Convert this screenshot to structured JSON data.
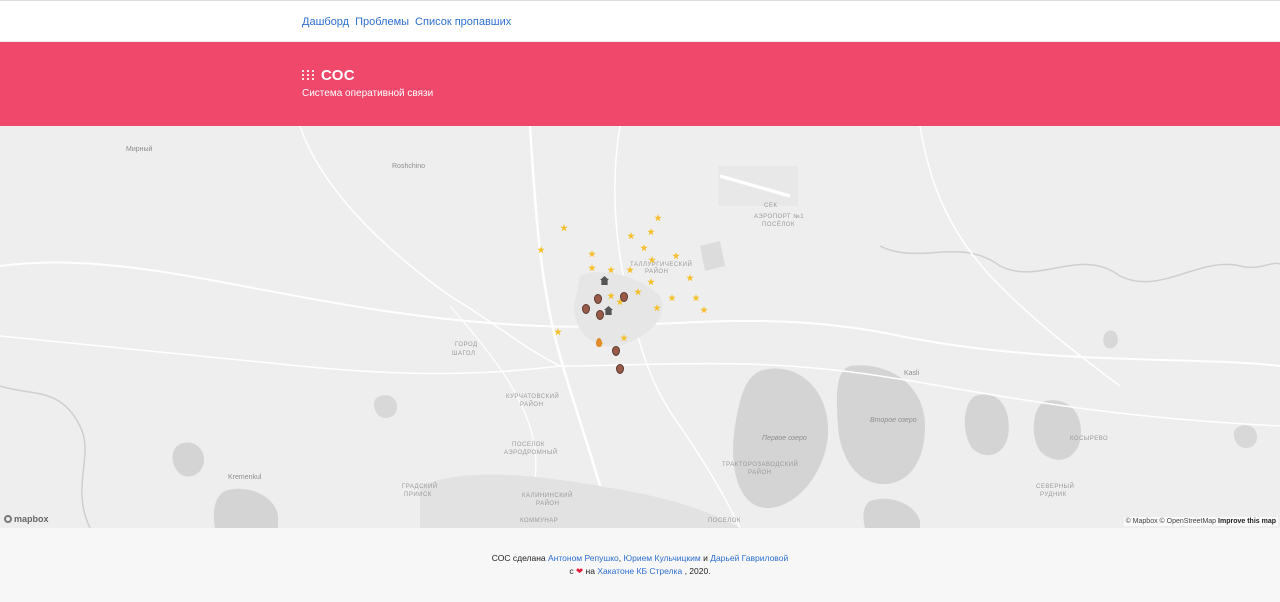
{
  "nav": {
    "dashboard": "Дашборд",
    "problems": "Проблемы",
    "missing_list": "Список пропавших"
  },
  "hero": {
    "title": "СОС",
    "subtitle": "Система оперативной связи"
  },
  "map": {
    "labels": {
      "mirny": "Мирный",
      "roshchino": "Roshchino",
      "airport": "АЭРОПОРТ №1",
      "airport2": "ПОСЁЛОК",
      "sek": "СЕК",
      "district_top": "ТАЛЛУРГИЧЕСКИЙ",
      "district_top2": "РАЙОН",
      "gorod": "ГОРОД",
      "shagol": "ШАГОЛ",
      "kurchatov": "КУРЧАТОВСКИЙ",
      "kurchatov2": "РАЙОН",
      "aerodromny": "ПОСЕЛОК",
      "aerodromny2": "АЭРОДРОМНЫЙ",
      "kalininsky": "КАЛИНИНСКИЙ",
      "kalininsky2": "РАЙОН",
      "gradsky": "ГРАДСКИЙ",
      "gradsky2": "ПРИИСК",
      "kommunar": "КОММУНАР",
      "pervoe_ozero": "Первое озеро",
      "vtoroe_ozero": "Второе озеро",
      "traktoroz": "ТРАКТОРОЗАВОДСКИЙ",
      "traktoroz2": "РАЙОН",
      "kasli": "Kasli",
      "kosyrevo": "КОСЫРЕВО",
      "severny": "СЕВЕРНЫЙ",
      "severny2": "РУДНИК",
      "kremenkul": "Kremenkul",
      "poselok": "ПОСЕЛОК"
    },
    "logo_text": "mapbox",
    "attribution": {
      "mapbox": "© Mapbox",
      "osm": "© OpenStreetMap",
      "improve": "Improve this map"
    },
    "marker_colors": {
      "fire": "#f5bf2a",
      "house": "#555555",
      "pin": "#9a5a4a"
    }
  },
  "footer": {
    "prefix": "СОС сделана",
    "author1": "Антоном Репушко",
    "sep1": ",",
    "author2": "Юрием Кульчицким",
    "and": "и",
    "author3": "Дарьей Гавриловой",
    "with": "с",
    "heart": "❤",
    "on": "на",
    "event": "Хакатоне КБ Стрелка",
    "year": ", 2020."
  }
}
